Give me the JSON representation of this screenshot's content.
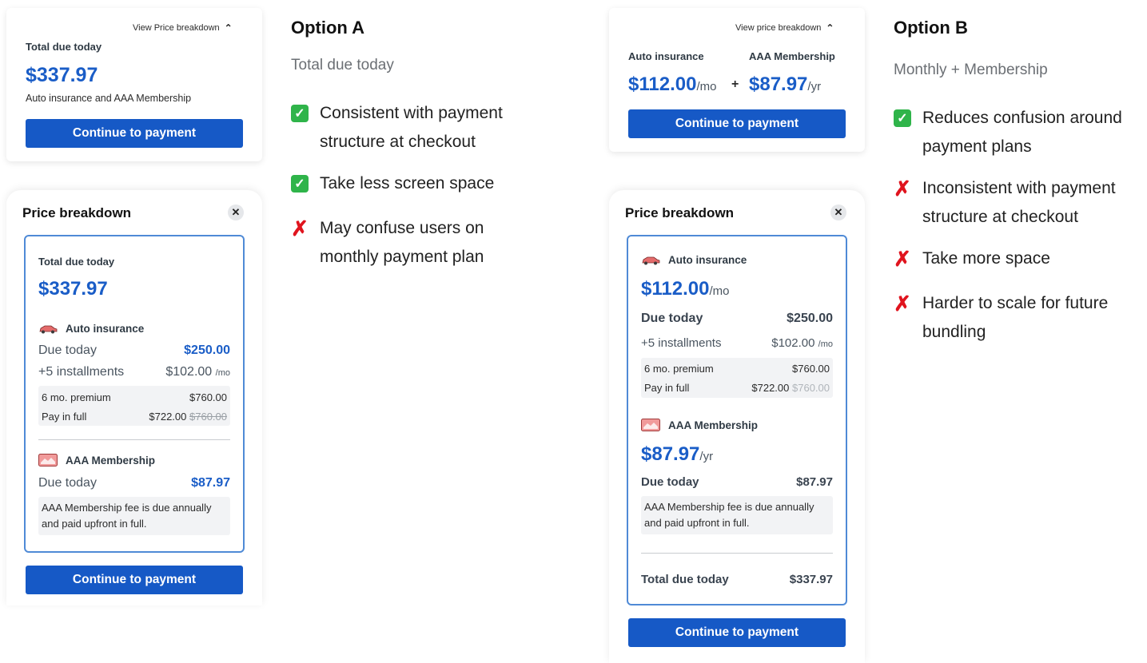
{
  "colors": {
    "brand_blue": "#1659c6",
    "price_blue": "#1a5dc7",
    "check_green": "#2fb44a",
    "cross_red": "#e0141e"
  },
  "option_a": {
    "card": {
      "view_breakdown": "View Price breakdown",
      "total_label": "Total due today",
      "total": "$337.97",
      "desc": "Auto insurance and AAA Membership",
      "button": "Continue to payment"
    },
    "sheet": {
      "title": "Price breakdown",
      "total_label": "Total due today",
      "total": "$337.97",
      "auto": {
        "label": "Auto insurance",
        "due_label": "Due today",
        "due_value": "$250.00",
        "inst_label": "+5 installments",
        "inst_value": "$102.00",
        "inst_unit": "/mo",
        "premium_label": "6 mo. premium",
        "premium_value": "$760.00",
        "payfull_label": "Pay in full",
        "payfull_value": "$722.00",
        "payfull_old": "$760.00"
      },
      "aaa": {
        "label": "AAA Membership",
        "due_label": "Due today",
        "due_value": "$87.97",
        "note_line1": "AAA Membership fee is due annually",
        "note_line2": "and paid upfront in full."
      },
      "button": "Continue to payment"
    },
    "title": "Option A",
    "subtitle": "Total due today",
    "bullets": [
      {
        "type": "check",
        "line1": "Consistent with payment",
        "line2": "structure at checkout"
      },
      {
        "type": "check",
        "line1": "Take less screen space",
        "line2": ""
      },
      {
        "type": "cross",
        "line1": "May confuse users on",
        "line2": "monthly payment plan"
      }
    ]
  },
  "option_b": {
    "card": {
      "view_breakdown": "View price breakdown",
      "auto_label": "Auto insurance",
      "aaa_label": "AAA Membership",
      "auto_price": "$112.00",
      "auto_unit": "/mo",
      "plus": "+",
      "aaa_price": "$87.97",
      "aaa_unit": "/yr",
      "button": "Continue to payment"
    },
    "sheet": {
      "title": "Price breakdown",
      "auto": {
        "label": "Auto insurance",
        "price": "$112.00",
        "unit": "/mo",
        "due_label": "Due today",
        "due_value": "$250.00",
        "inst_label": "+5 installments",
        "inst_value": "$102.00",
        "inst_unit": "/mo",
        "premium_label": "6 mo. premium",
        "premium_value": "$760.00",
        "payfull_label": "Pay in full",
        "payfull_value": "$722.00",
        "payfull_old": "$760.00"
      },
      "aaa": {
        "label": "AAA Membership",
        "price": "$87.97",
        "unit": "/yr",
        "due_label": "Due today",
        "due_value": "$87.97",
        "note_line1": "AAA Membership fee is due annually",
        "note_line2": "and paid upfront in full."
      },
      "total_label": "Total due today",
      "total_value": "$337.97",
      "button": "Continue to payment"
    },
    "title": "Option B",
    "subtitle": "Monthly + Membership",
    "bullets": [
      {
        "type": "check",
        "line1": "Reduces confusion around",
        "line2": "payment plans"
      },
      {
        "type": "cross",
        "line1": "Inconsistent with payment",
        "line2": "structure at checkout"
      },
      {
        "type": "cross",
        "line1": "Take more space",
        "line2": ""
      },
      {
        "type": "cross",
        "line1": "Harder to scale for future",
        "line2": "bundling"
      }
    ]
  },
  "icons": {
    "close": "close-icon",
    "chevron": "chevron-up-icon",
    "car": "car-icon",
    "card": "membership-card-icon",
    "check": "check-icon",
    "cross": "cross-icon"
  }
}
